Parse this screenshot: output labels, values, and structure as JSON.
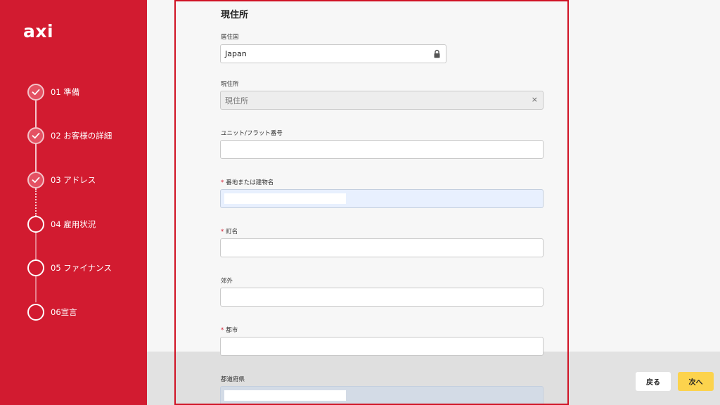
{
  "brand": {
    "logo_text": "axi",
    "accent": "#d21b30"
  },
  "steps": [
    {
      "label": "01 準備",
      "status": "done"
    },
    {
      "label": "02 お客様の詳細",
      "status": "done"
    },
    {
      "label": "03 アドレス",
      "status": "done"
    },
    {
      "label": "04 雇用状況",
      "status": "pending"
    },
    {
      "label": "05 ファイナンス",
      "status": "pending"
    },
    {
      "label": "06宣言",
      "status": "pending"
    }
  ],
  "form": {
    "title": "現住所",
    "fields": {
      "country": {
        "label": "居住国",
        "value": "Japan",
        "icon": "lock-icon"
      },
      "current_address": {
        "label": "現住所",
        "placeholder": "現住所",
        "icon": "clear-icon",
        "clear_glyph": "×"
      },
      "unit": {
        "label": "ユニット/フラット番号",
        "value": ""
      },
      "street": {
        "label": "番地または建物名",
        "required": true,
        "value": ""
      },
      "town": {
        "label": "町名",
        "required": true,
        "value": ""
      },
      "suburb": {
        "label": "郊外",
        "value": ""
      },
      "city": {
        "label": "都市",
        "required": true,
        "value": ""
      },
      "prefecture": {
        "label": "都道府県",
        "value": ""
      }
    },
    "required_marker": "*"
  },
  "buttons": {
    "back": "戻る",
    "next": "次へ"
  }
}
